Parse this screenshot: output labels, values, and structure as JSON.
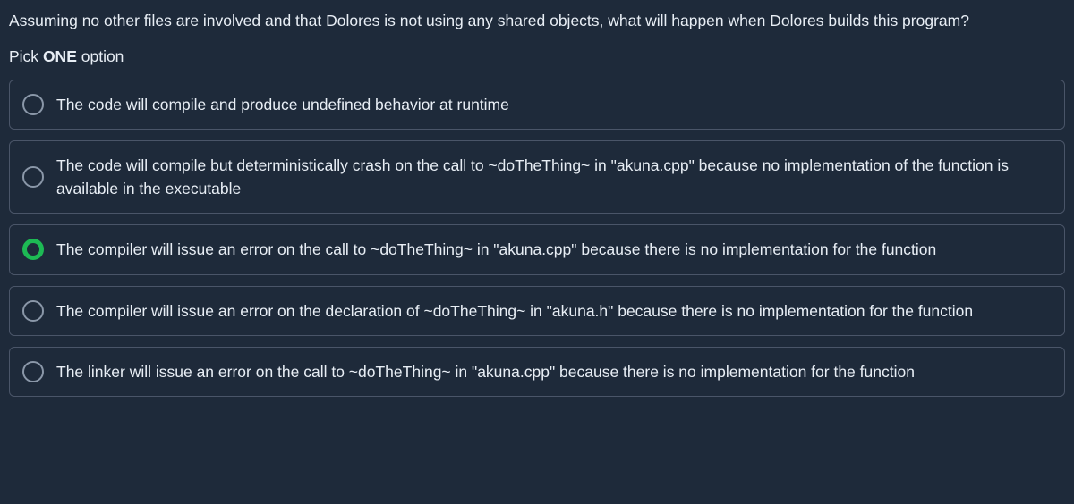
{
  "question": "Assuming no other files are involved and that Dolores is not using any shared objects, what will happen when Dolores builds this program?",
  "instruction_prefix": "Pick ",
  "instruction_bold": "ONE",
  "instruction_suffix": " option",
  "options": [
    {
      "text": "The code will compile and produce undefined behavior at runtime",
      "selected": false
    },
    {
      "text": "The code will compile but deterministically crash on the call to ~doTheThing~ in \"akuna.cpp\" because no implementation of the function is available in the executable",
      "selected": false
    },
    {
      "text": "The compiler will issue an error on the call to ~doTheThing~ in \"akuna.cpp\" because there is no implementation for the function",
      "selected": true
    },
    {
      "text": "The compiler will issue an error on the declaration of ~doTheThing~ in \"akuna.h\" because there is no implementation for the function",
      "selected": false
    },
    {
      "text": "The linker will issue an error on the call to ~doTheThing~ in \"akuna.cpp\" because there is no implementation for the function",
      "selected": false
    }
  ]
}
